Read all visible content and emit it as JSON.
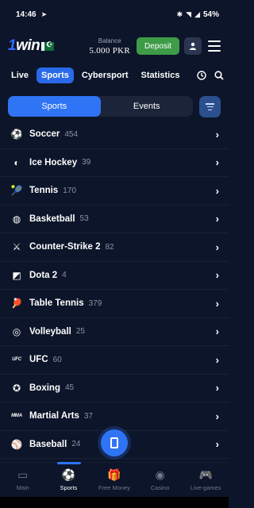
{
  "status_bar": {
    "time": "14:46",
    "battery": "54%"
  },
  "header": {
    "logo_one": "1",
    "logo_win": "win",
    "balance_label": "Balance",
    "balance_value": "5.000 PKR",
    "deposit_label": "Deposit"
  },
  "tabs": [
    {
      "label": "Live"
    },
    {
      "label": "Sports"
    },
    {
      "label": "Cybersport"
    },
    {
      "label": "Statistics"
    }
  ],
  "segment": {
    "left": "Sports",
    "right": "Events"
  },
  "sports": [
    {
      "name": "Soccer",
      "count": "454",
      "icon": "soccer-icon",
      "glyph": "⚽"
    },
    {
      "name": "Ice Hockey",
      "count": "39",
      "icon": "ice-hockey-icon",
      "glyph": "◐"
    },
    {
      "name": "Tennis",
      "count": "170",
      "icon": "tennis-icon",
      "glyph": "🎾"
    },
    {
      "name": "Basketball",
      "count": "53",
      "icon": "basketball-icon",
      "glyph": "◍"
    },
    {
      "name": "Counter-Strike 2",
      "count": "82",
      "icon": "counter-strike-icon",
      "glyph": "⚔"
    },
    {
      "name": "Dota 2",
      "count": "4",
      "icon": "dota-icon",
      "glyph": "◩"
    },
    {
      "name": "Table Tennis",
      "count": "379",
      "icon": "table-tennis-icon",
      "glyph": "🏓"
    },
    {
      "name": "Volleyball",
      "count": "25",
      "icon": "volleyball-icon",
      "glyph": "◎"
    },
    {
      "name": "UFC",
      "count": "60",
      "icon": "ufc-icon",
      "glyph": "UFC"
    },
    {
      "name": "Boxing",
      "count": "45",
      "icon": "boxing-icon",
      "glyph": "✪"
    },
    {
      "name": "Martial Arts",
      "count": "37",
      "icon": "martial-arts-icon",
      "glyph": "MMA"
    },
    {
      "name": "Baseball",
      "count": "24",
      "icon": "baseball-icon",
      "glyph": "⚾"
    }
  ],
  "bottom_nav": [
    {
      "label": "Main"
    },
    {
      "label": "Sports"
    },
    {
      "label": "Free Money"
    },
    {
      "label": "Casino"
    },
    {
      "label": "Live-games"
    }
  ],
  "colors": {
    "accent": "#2f74f5",
    "deposit": "#3e9b48",
    "background": "#0c1529"
  }
}
